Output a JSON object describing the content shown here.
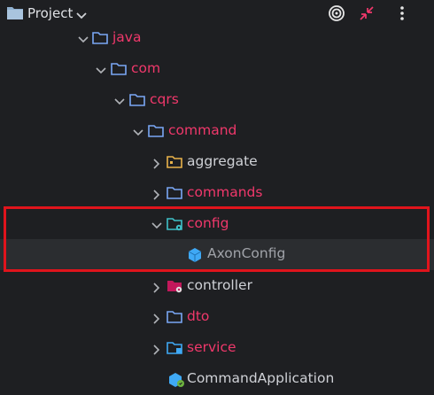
{
  "header": {
    "title": "Project",
    "icons": [
      "project-folder-icon",
      "chevron-down-icon",
      "target-icon",
      "collapse-icon",
      "more-icon"
    ]
  },
  "tree": {
    "java": "java",
    "com": "com",
    "cqrs": "cqrs",
    "command": "command",
    "aggregate": "aggregate",
    "commands": "commands",
    "config": "config",
    "axonconfig": "AxonConfig",
    "controller": "controller",
    "dto": "dto",
    "service": "service",
    "commandapplication": "CommandApplication"
  },
  "colors": {
    "background": "#1e1f22",
    "selected_row": "#2b2d30",
    "folder_blue": "#7aa7f5",
    "pink_text": "#f0386b",
    "highlight_border": "#e0141c"
  }
}
